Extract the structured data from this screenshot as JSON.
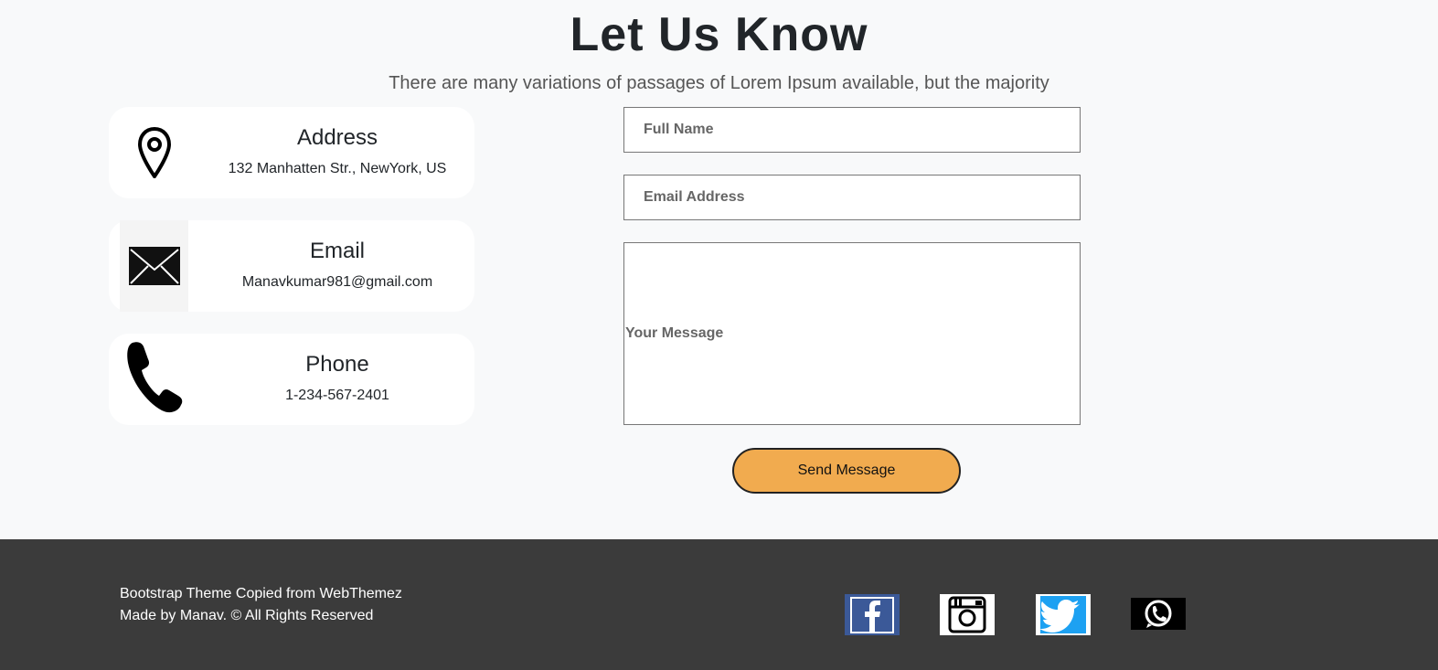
{
  "header": {
    "title": "Let Us Know",
    "subtitle": "There are many variations of passages of Lorem Ipsum available, but the majority"
  },
  "cards": {
    "address": {
      "heading": "Address",
      "value": "132 Manhatten Str., NewYork, US",
      "icon": "map-pin-icon"
    },
    "email": {
      "heading": "Email",
      "value": "Manavkumar981@gmail.com",
      "icon": "envelope-icon"
    },
    "phone": {
      "heading": "Phone",
      "value": "1-234-567-2401",
      "icon": "phone-icon"
    }
  },
  "form": {
    "full_name_placeholder": "Full Name",
    "email_placeholder": "Email Address",
    "message_placeholder": "Your Message",
    "submit_label": "Send Message"
  },
  "footer": {
    "line1": "Bootstrap Theme Copied from WebThemez",
    "line2": "Made by Manav. © All Rights Reserved",
    "social": [
      "facebook-icon",
      "instagram-icon",
      "twitter-icon",
      "whatsapp-icon"
    ]
  },
  "colors": {
    "accent": "#f1ab4f",
    "footer_bg": "#3b3b3b",
    "page_bg": "#f8f9fa",
    "facebook": "#3b5998",
    "twitter": "#1da1f2"
  }
}
